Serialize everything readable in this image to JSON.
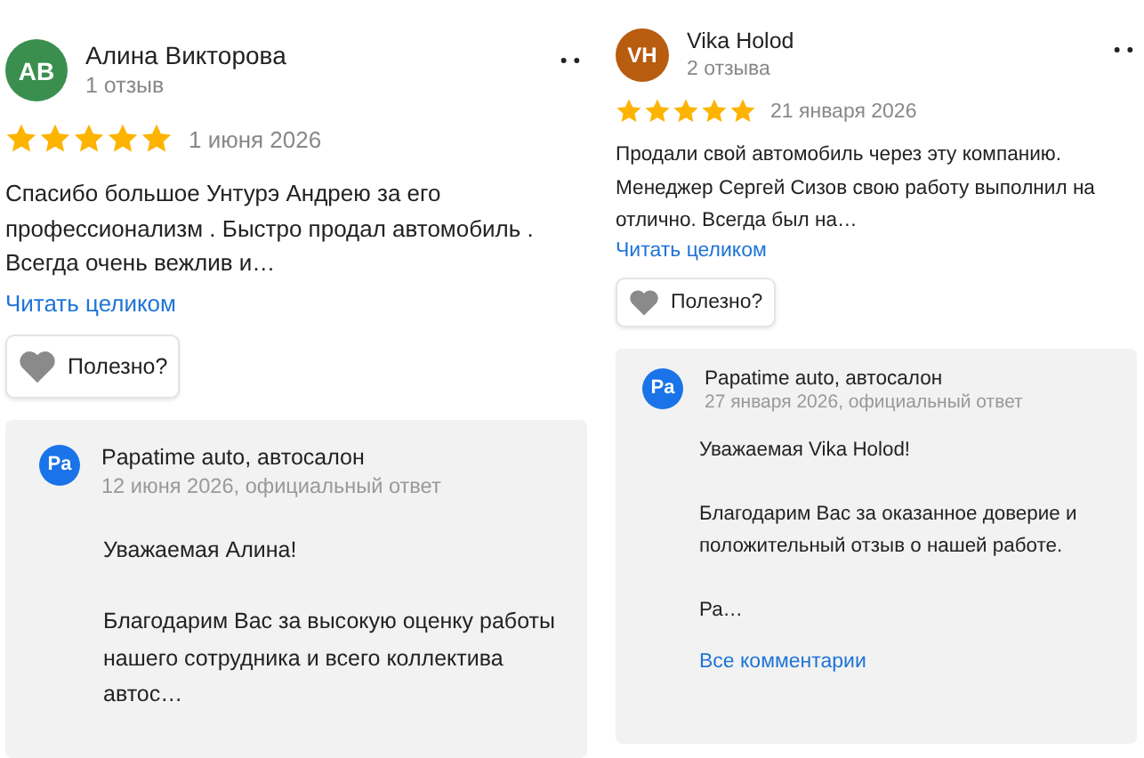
{
  "reviews": [
    {
      "initials": "АВ",
      "color": "#3a8f4f",
      "author": "Алина Викторова",
      "review_count": "1 отзыв",
      "stars": 5,
      "date": "1 июня 2026",
      "text": "Спасибо большое Унтурэ Андрею за его профессионализм . Быстро продал автомобиль . Всегда очень вежлив и…",
      "read_more": "Читать целиком",
      "helpful": "Полезно?",
      "reply": {
        "logo": "Pa",
        "company": "Papatime auto, автосалон",
        "meta": "12 июня 2026, официальный ответ",
        "paragraphs": [
          "Уважаемая Алина!",
          "Благодарим Вас за высокую оценку работы нашего сотрудника и всего коллектива автос…"
        ]
      }
    },
    {
      "initials": "VH",
      "color": "#b85c0f",
      "author": "Vika Holod",
      "review_count": "2 отзыва",
      "stars": 5,
      "date": "21 января 2026",
      "text": "Продали свой автомобиль через эту компанию. Менеджер Сергей Сизов свою работу выполнил на отлично. Всегда был на…",
      "read_more": "Читать целиком",
      "helpful": "Полезно?",
      "reply": {
        "logo": "Pa",
        "company": "Papatime auto, автосалон",
        "meta": "27 января 2026, официальный ответ",
        "paragraphs": [
          "Уважаемая Vika Holod!",
          "Благодарим Вас за оказанное доверие и положительный отзыв о нашей работе.",
          "Ра…"
        ],
        "all_comments": "Все комментарии"
      }
    }
  ]
}
